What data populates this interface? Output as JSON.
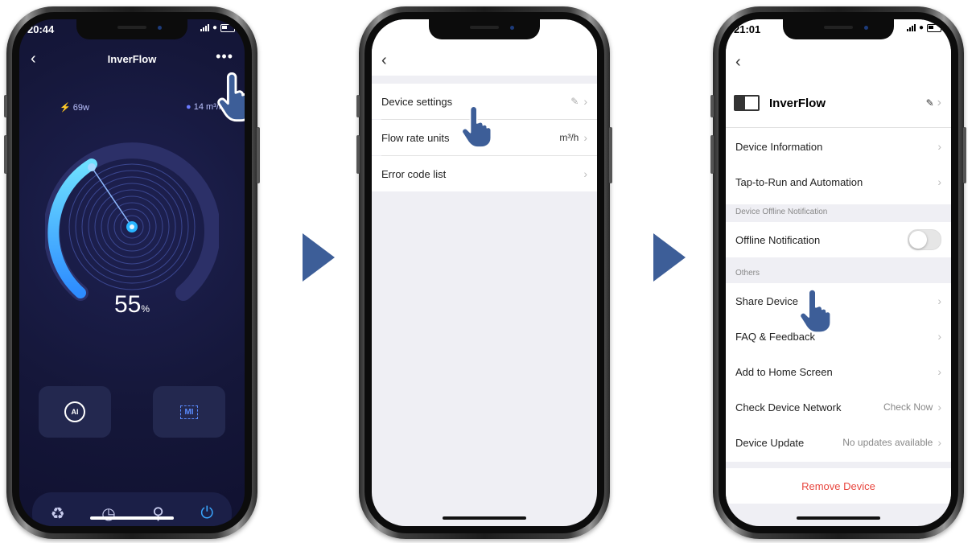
{
  "phone1": {
    "time": "20:44",
    "title": "InverFlow",
    "power": "69w",
    "flow": "14 m³/h",
    "percent_value": "55",
    "percent_unit": "%",
    "mode_ai": "AI",
    "mode_mi": "MI",
    "tabs": [
      "recycle-icon",
      "clock-icon",
      "search-icon",
      "power-icon"
    ]
  },
  "phone2": {
    "rows": [
      {
        "label": "Device settings",
        "value": ""
      },
      {
        "label": "Flow rate units",
        "value": "m³/h"
      },
      {
        "label": "Error code list",
        "value": ""
      }
    ]
  },
  "phone3": {
    "time": "21:01",
    "device_name": "InverFlow",
    "rows_top": [
      {
        "label": "Device Information"
      },
      {
        "label": "Tap-to-Run and Automation"
      }
    ],
    "offline_section": "Device Offline Notification",
    "offline_label": "Offline Notification",
    "offline_enabled": false,
    "others_section": "Others",
    "rows_others": [
      {
        "label": "Share Device",
        "value": ""
      },
      {
        "label": "FAQ & Feedback",
        "value": ""
      },
      {
        "label": "Add to Home Screen",
        "value": ""
      },
      {
        "label": "Check Device Network",
        "value": "Check Now"
      },
      {
        "label": "Device Update",
        "value": "No updates available"
      }
    ],
    "remove_label": "Remove Device"
  },
  "colors": {
    "accent_blue": "#3d5e98",
    "remove_red": "#e8473f",
    "gauge_cyan": "#3aa6ff"
  }
}
